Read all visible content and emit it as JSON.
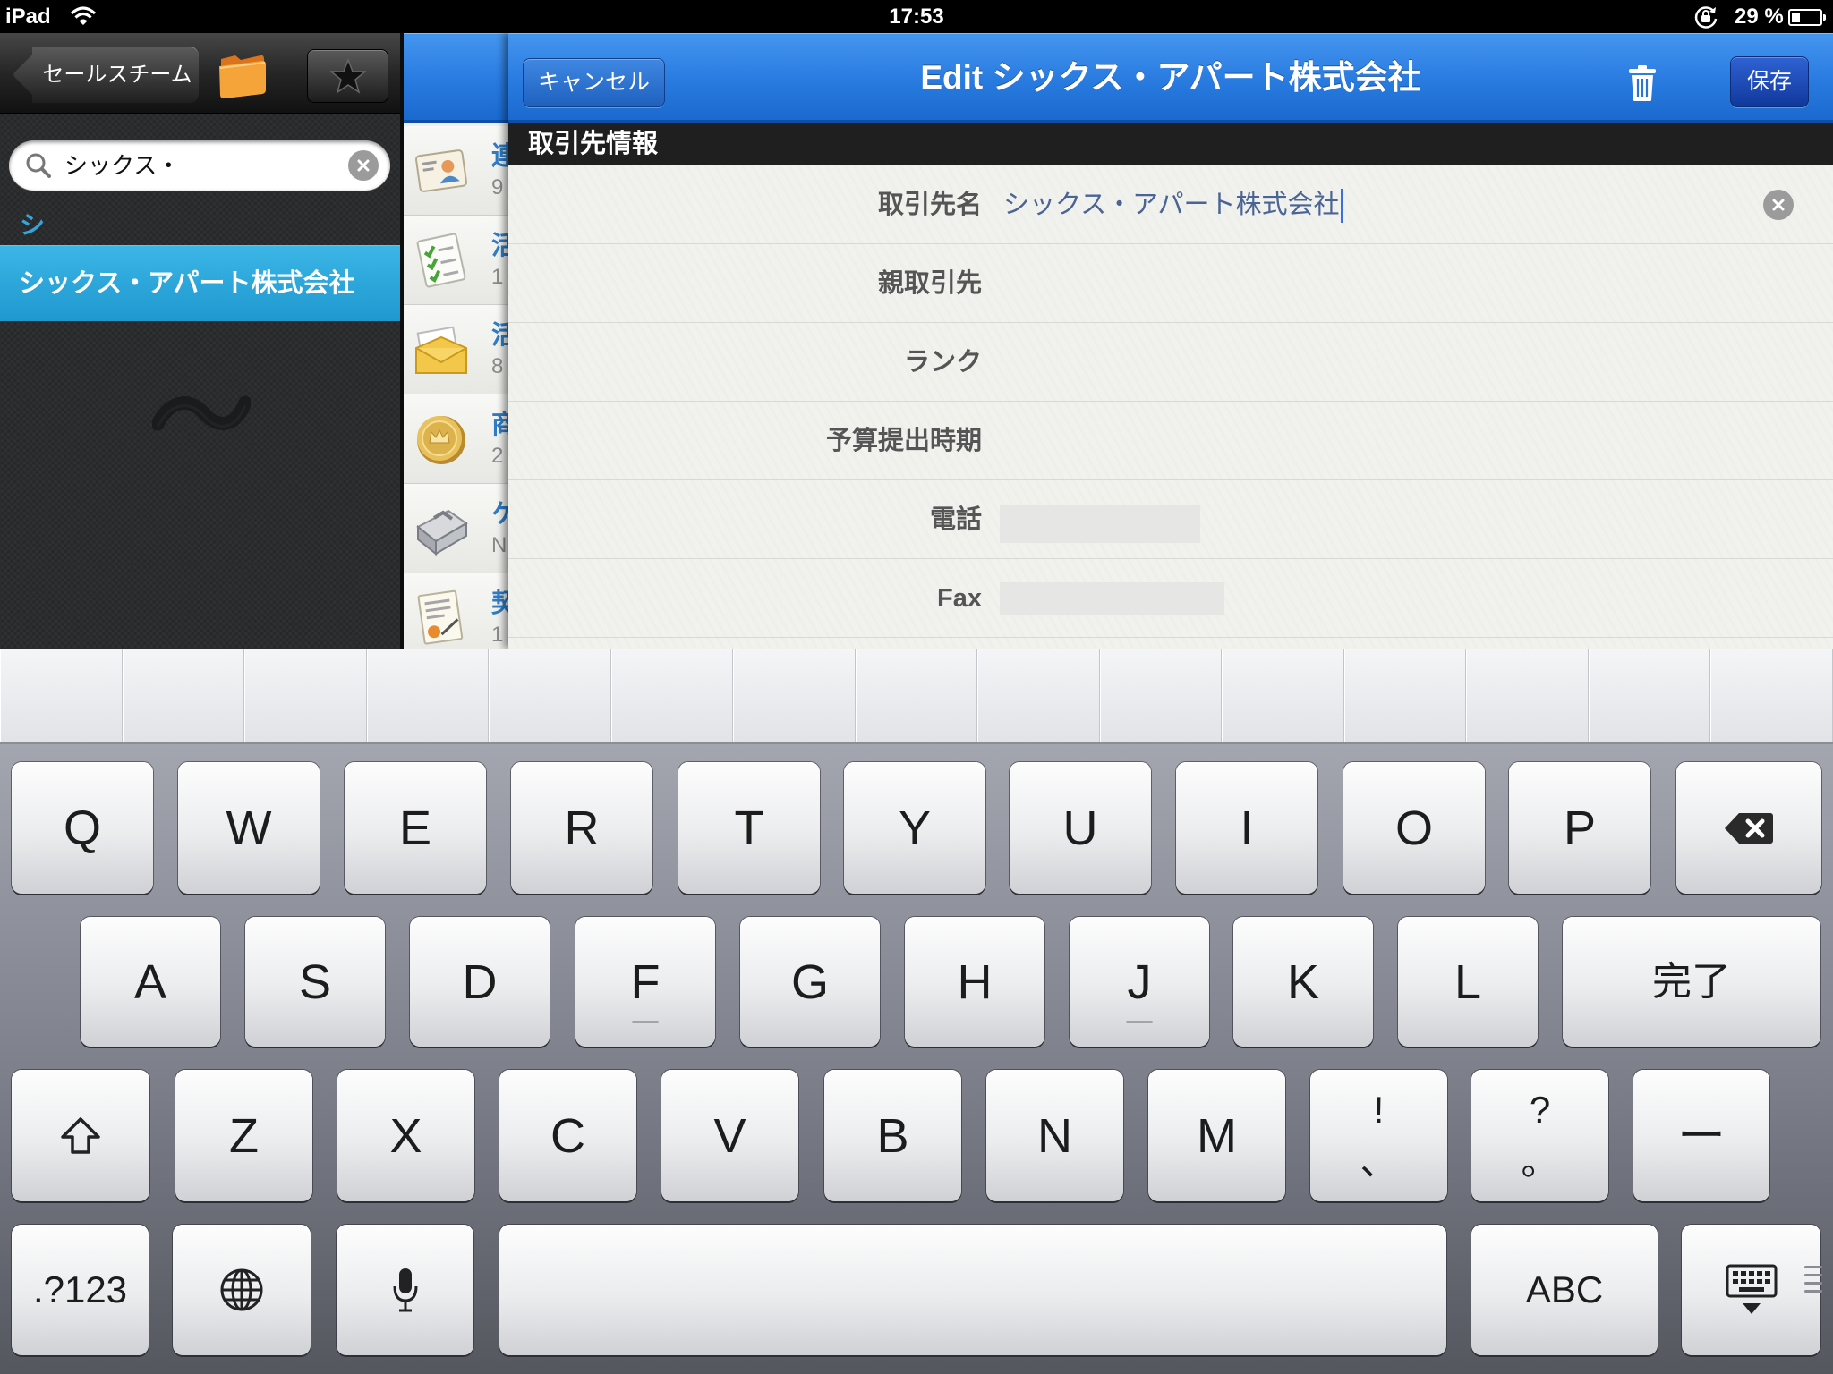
{
  "status_bar": {
    "carrier": "iPad",
    "time": "17:53",
    "battery": "29 %",
    "battery_level": 0.29,
    "icons": [
      "wifi-icon",
      "orientation-lock-icon",
      "battery-icon"
    ]
  },
  "sidebar": {
    "back_label": "セールスチーム",
    "icons": [
      "folder-icon",
      "star-icon"
    ],
    "search": {
      "value": "シックス・"
    },
    "section_header": "シ",
    "items": [
      {
        "label": "シックス・アパート株式会社",
        "selected": true
      }
    ]
  },
  "related_list": {
    "items": [
      {
        "icon": "contact-card-icon",
        "title": "連",
        "subtitle": "9"
      },
      {
        "icon": "task-checklist-icon",
        "title": "活",
        "subtitle": "1"
      },
      {
        "icon": "envelope-icon",
        "title": "活",
        "subtitle": "8"
      },
      {
        "icon": "coin-icon",
        "title": "商",
        "subtitle": "2"
      },
      {
        "icon": "case-icon",
        "title": "ケ",
        "subtitle": "N"
      },
      {
        "icon": "contract-icon",
        "title": "契",
        "subtitle": "1"
      }
    ]
  },
  "editor": {
    "cancel_label": "キャンセル",
    "title": "Edit シックス・アパート株式会社",
    "save_label": "保存",
    "section_title": "取引先情報",
    "fields": [
      {
        "label": "取引先名",
        "value": "シックス・アパート株式会社"
      },
      {
        "label": "親取引先",
        "value": ""
      },
      {
        "label": "ランク",
        "value": ""
      },
      {
        "label": "予算提出時期",
        "value": ""
      },
      {
        "label": "電話",
        "value": ""
      },
      {
        "label": "Fax",
        "value": ""
      }
    ]
  },
  "keyboard": {
    "row1": [
      "Q",
      "W",
      "E",
      "R",
      "T",
      "Y",
      "U",
      "I",
      "O",
      "P"
    ],
    "row2": [
      "A",
      "S",
      "D",
      "F",
      "G",
      "H",
      "J",
      "K",
      "L"
    ],
    "return_label": "完了",
    "row3": [
      "Z",
      "X",
      "C",
      "V",
      "B",
      "N",
      "M"
    ],
    "punct": [
      {
        "top": "!",
        "bottom": "、"
      },
      {
        "top": "?",
        "bottom": "。"
      }
    ],
    "dash": "ー",
    "numbers_label": ".?123",
    "abc_label": "ABC",
    "icons": {
      "backspace": "backspace-icon",
      "shift": "shift-icon",
      "globe": "globe-icon",
      "mic": "microphone-icon",
      "dismiss": "keyboard-dismiss-icon"
    }
  },
  "colors": {
    "nav_blue": "#1a69cf",
    "selection": "#1e98cf",
    "section_index": "#35a6dc",
    "field_value": "#4a6494"
  }
}
